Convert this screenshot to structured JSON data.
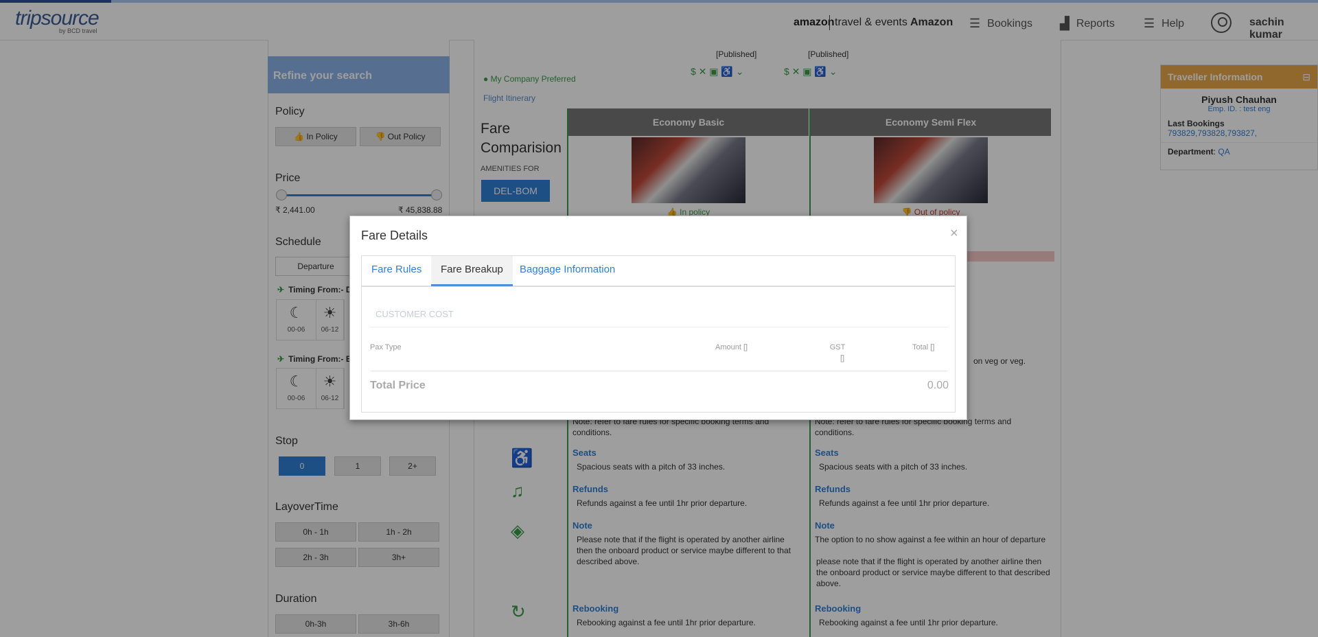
{
  "header": {
    "logo": "tripsource",
    "logo_sub": "by BCD travel",
    "amazon_logo": "amazon",
    "amazon_sub": "travel & events",
    "company": "Amazon",
    "nav": [
      {
        "label": "Bookings",
        "icon": "menu-icon"
      },
      {
        "label": "Reports",
        "icon": "bar-chart-icon"
      },
      {
        "label": "Help",
        "icon": "menu-icon"
      }
    ],
    "user": "sachin kumar"
  },
  "sidebar": {
    "refine": "Refine your search",
    "policy_title": "Policy",
    "in_policy": "In Policy",
    "out_policy": "Out Policy",
    "price_title": "Price",
    "price_min": "₹ 2,441.00",
    "price_max": "₹ 45,838.88",
    "schedule_title": "Schedule",
    "departure": "Departure",
    "timing1": "Timing From:- D",
    "timing2": "Timing From:- B",
    "time_a": "00-06",
    "time_b": "06-12",
    "stop_title": "Stop",
    "stops": [
      "0",
      "1",
      "2+"
    ],
    "layover_title": "LayoverTime",
    "layovers": [
      "0h - 1h",
      "1h - 2h",
      "2h - 3h",
      "3h+"
    ],
    "duration_title": "Duration",
    "durations": [
      "0h-3h",
      "3h-6h"
    ]
  },
  "main": {
    "published1": "[Published]",
    "published2": "[Published]",
    "my_company_preferred": "My Company Preferred",
    "flight_itinerary": "Flight Itinerary",
    "fare_comparison": "Fare Comparision",
    "amenities_for": "AMENITIES FOR",
    "route": "DEL-BOM",
    "col1": {
      "title": "Economy Basic",
      "policy": "In policy",
      "meal_tail": "",
      "note_tail": "Note: refer to fare rules for specific booking terms and conditions.",
      "seats_title": "Seats",
      "seats": "Spacious seats with a pitch of 33 inches.",
      "refunds_title": "Refunds",
      "refunds": "Refunds against a fee until 1hr prior departure.",
      "note_title": "Note",
      "note": "Please note that if the flight is operated by another airline then the onboard product or service maybe different to that described above.",
      "rebooking_title": "Rebooking",
      "rebooking": "Rebooking against a fee until 1hr prior departure."
    },
    "col2": {
      "title": "Economy Semi Flex",
      "policy": "Out of policy",
      "meal_tail": "on veg or veg.",
      "note_tail": "Note: refer to fare rules for specific booking terms and conditions.",
      "seats_title": "Seats",
      "seats": "Spacious seats with a pitch of 33 inches.",
      "refunds_title": "Refunds",
      "refunds": "Refunds against a fee until 1hr prior departure.",
      "note_title": "Note",
      "note1": "The option to no show against a fee within an hour of departure",
      "note2": "please note that if the flight is operated by another airline then the onboard product or service maybe different to that described above.",
      "rebooking_title": "Rebooking",
      "rebooking": "Rebooking against a fee until 1hr prior departure."
    }
  },
  "traveller": {
    "title": "Traveller Information",
    "name": "Piyush Chauhan",
    "emp": "Emp. ID. : test eng",
    "last_bookings_label": "Last Bookings",
    "last_bookings": "793829,793828,793827,",
    "department_label": "Department",
    "department": "QA"
  },
  "modal": {
    "title": "Fare Details",
    "close": "×",
    "tabs": [
      "Fare Rules",
      "Fare Breakup",
      "Baggage Information"
    ],
    "active_tab": "Fare Breakup",
    "customer_cost": "CUSTOMER COST",
    "col_pax": "Pax Type",
    "col_amount": "Amount []",
    "col_gst": "GST",
    "col_gst2": "[]",
    "col_total": "Total []",
    "total_label": "Total Price",
    "total_value": "0.00"
  },
  "colors": {
    "accent": "#2f7fd6",
    "green": "#3a9b4a",
    "traveller_header": "#e8a84a"
  }
}
